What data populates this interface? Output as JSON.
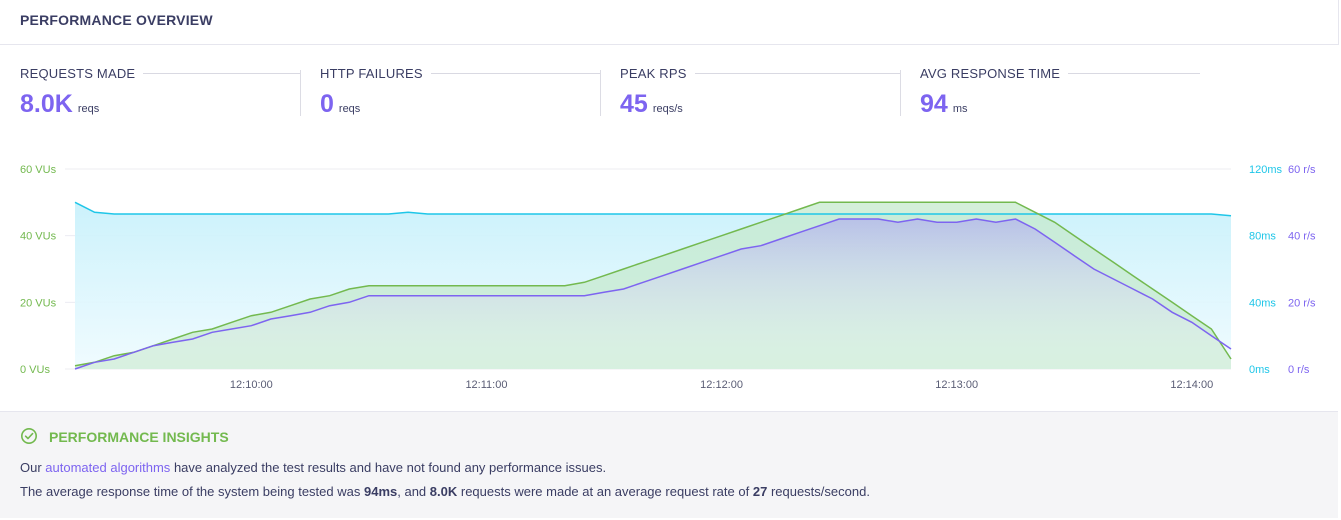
{
  "header": {
    "title": "PERFORMANCE OVERVIEW"
  },
  "stats": [
    {
      "label": "REQUESTS MADE",
      "value": "8.0K",
      "unit": "reqs"
    },
    {
      "label": "HTTP FAILURES",
      "value": "0",
      "unit": "reqs"
    },
    {
      "label": "PEAK RPS",
      "value": "45",
      "unit": "reqs/s"
    },
    {
      "label": "AVG RESPONSE TIME",
      "value": "94",
      "unit": "ms"
    }
  ],
  "colors": {
    "vus": "#73b94f",
    "rps": "#7d64f0",
    "response": "#1fc6e8",
    "accent": "#7d64f0"
  },
  "chart_data": {
    "type": "line",
    "x": [
      "12:09:15",
      "12:09:20",
      "12:09:25",
      "12:09:30",
      "12:09:35",
      "12:09:40",
      "12:09:45",
      "12:09:50",
      "12:09:55",
      "12:10:00",
      "12:10:05",
      "12:10:10",
      "12:10:15",
      "12:10:20",
      "12:10:25",
      "12:10:30",
      "12:10:35",
      "12:10:40",
      "12:10:45",
      "12:10:50",
      "12:10:55",
      "12:11:00",
      "12:11:05",
      "12:11:10",
      "12:11:15",
      "12:11:20",
      "12:11:25",
      "12:11:30",
      "12:11:35",
      "12:11:40",
      "12:11:45",
      "12:11:50",
      "12:11:55",
      "12:12:00",
      "12:12:05",
      "12:12:10",
      "12:12:15",
      "12:12:20",
      "12:12:25",
      "12:12:30",
      "12:12:35",
      "12:12:40",
      "12:12:45",
      "12:12:50",
      "12:12:55",
      "12:13:00",
      "12:13:05",
      "12:13:10",
      "12:13:15",
      "12:13:20",
      "12:13:25",
      "12:13:30",
      "12:13:35",
      "12:13:40",
      "12:13:45",
      "12:13:50",
      "12:13:55",
      "12:14:00",
      "12:14:05",
      "12:14:10"
    ],
    "x_ticks": [
      "12:10:00",
      "12:11:00",
      "12:12:00",
      "12:13:00",
      "12:14:00"
    ],
    "series": [
      {
        "name": "VUs",
        "axis": "left",
        "unit": "VUs",
        "values": [
          1,
          2,
          4,
          5,
          7,
          9,
          11,
          12,
          14,
          16,
          17,
          19,
          21,
          22,
          24,
          25,
          25,
          25,
          25,
          25,
          25,
          25,
          25,
          25,
          25,
          25,
          26,
          28,
          30,
          32,
          34,
          36,
          38,
          40,
          42,
          44,
          46,
          48,
          50,
          50,
          50,
          50,
          50,
          50,
          50,
          50,
          50,
          50,
          50,
          47,
          44,
          40,
          36,
          32,
          28,
          24,
          20,
          16,
          12,
          3
        ]
      },
      {
        "name": "Requests per second",
        "axis": "right",
        "unit": "r/s",
        "values": [
          0,
          2,
          3,
          5,
          7,
          8,
          9,
          11,
          12,
          13,
          15,
          16,
          17,
          19,
          20,
          22,
          22,
          22,
          22,
          22,
          22,
          22,
          22,
          22,
          22,
          22,
          22,
          23,
          24,
          26,
          28,
          30,
          32,
          34,
          36,
          37,
          39,
          41,
          43,
          45,
          45,
          45,
          44,
          45,
          44,
          44,
          45,
          44,
          45,
          42,
          38,
          34,
          30,
          27,
          24,
          21,
          17,
          14,
          10,
          6
        ]
      },
      {
        "name": "Response time",
        "axis": "right2",
        "unit": "ms",
        "values": [
          100,
          94,
          93,
          93,
          93,
          93,
          93,
          93,
          93,
          93,
          93,
          93,
          93,
          93,
          93,
          93,
          93,
          94,
          93,
          93,
          93,
          93,
          93,
          93,
          93,
          93,
          93,
          93,
          93,
          93,
          93,
          93,
          93,
          93,
          93,
          93,
          93,
          93,
          93,
          93,
          93,
          93,
          93,
          93,
          93,
          93,
          93,
          93,
          93,
          93,
          93,
          93,
          93,
          93,
          93,
          93,
          93,
          93,
          93,
          92
        ]
      }
    ],
    "left_axis": {
      "ticks": [
        "0 VUs",
        "20 VUs",
        "40 VUs",
        "60 VUs"
      ],
      "ylim": [
        0,
        60
      ]
    },
    "right_axis_ms": {
      "ticks": [
        "0ms",
        "40ms",
        "80ms",
        "120ms"
      ],
      "ylim": [
        0,
        120
      ]
    },
    "right_axis_rps": {
      "ticks": [
        "0 r/s",
        "20 r/s",
        "40 r/s",
        "60 r/s"
      ],
      "ylim": [
        0,
        60
      ]
    },
    "grid": true
  },
  "insights": {
    "title": "PERFORMANCE INSIGHTS",
    "line1_pre": "Our",
    "line1_link": "automated algorithms",
    "line1_post": "have analyzed the test results and have not found any performance issues.",
    "line2_a": "The average response time of the system being tested was",
    "line2_b": "94ms",
    "line2_c": ", and",
    "line2_d": "8.0K",
    "line2_e": "requests were made at an average request rate of",
    "line2_f": "27",
    "line2_g": "requests/second."
  }
}
